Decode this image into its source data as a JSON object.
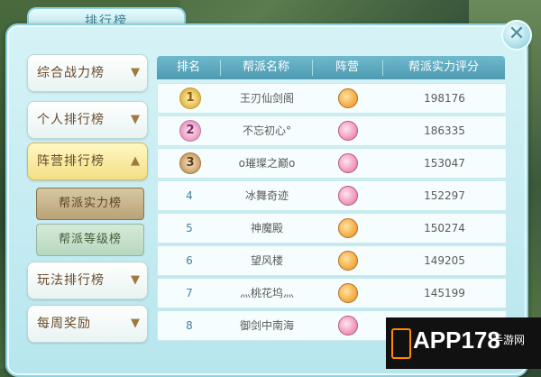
{
  "window": {
    "title": "排行榜",
    "close_icon": "close-icon"
  },
  "sidebar": {
    "categories": [
      {
        "label": "综合战力榜",
        "chevron": "chevron-down-icon"
      },
      {
        "label": "个人排行榜",
        "chevron": "chevron-down-icon"
      },
      {
        "label": "阵营排行榜",
        "chevron": "chevron-up-icon",
        "active": true
      },
      {
        "label": "玩法排行榜",
        "chevron": "chevron-down-icon"
      },
      {
        "label": "每周奖励",
        "chevron": "chevron-down-icon"
      }
    ],
    "subitems": [
      {
        "label": "帮派实力榜",
        "active": true
      },
      {
        "label": "帮派等级榜"
      }
    ]
  },
  "table": {
    "headers": [
      "排名",
      "帮派名称",
      "阵营",
      "帮派实力评分"
    ],
    "rows": [
      {
        "rank": "1",
        "medal": "gold",
        "name": "王刃仙剑阁",
        "faction": "orange",
        "score": "198176"
      },
      {
        "rank": "2",
        "medal": "pink",
        "name": "不忘初心°",
        "faction": "pink",
        "score": "186335"
      },
      {
        "rank": "3",
        "medal": "bronze",
        "name": "o璀璨之巅o",
        "faction": "pink",
        "score": "153047"
      },
      {
        "rank": "4",
        "name": "冰舞奇迹",
        "faction": "pink",
        "score": "152297"
      },
      {
        "rank": "5",
        "name": "神魔殿",
        "faction": "orange",
        "score": "150274"
      },
      {
        "rank": "6",
        "name": "望风楼",
        "faction": "orange",
        "score": "149205"
      },
      {
        "rank": "7",
        "name": "灬桃花坞灬",
        "faction": "orange",
        "score": "145199"
      },
      {
        "rank": "8",
        "name": "御剑中南海",
        "faction": "pink",
        "score": ""
      }
    ]
  },
  "watermark": {
    "text": "APP178",
    "sub": "手游网"
  },
  "colors": {
    "header_bg": "#5aa8bf",
    "active_tab": "#f4df86",
    "panel_bg": "#c6ecf2"
  }
}
